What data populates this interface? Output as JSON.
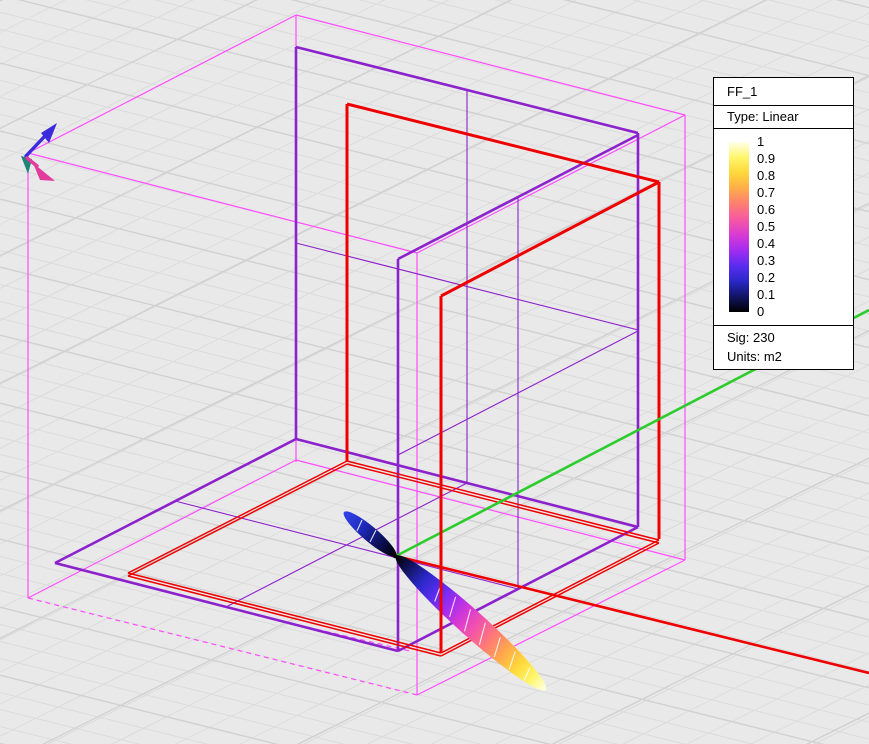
{
  "legend": {
    "title": "FF_1",
    "type_label": "Type: Linear",
    "sig_label": "Sig: 230",
    "units_label": "Units: m2",
    "scale_min": 0,
    "scale_max": 1,
    "ticks": [
      "1",
      "0.9",
      "0.8",
      "0.7",
      "0.6",
      "0.5",
      "0.4",
      "0.3",
      "0.2",
      "0.1",
      "0"
    ],
    "colorbar_stops": [
      "#ffffea",
      "#fff66a",
      "#ffd83a",
      "#ffac4a",
      "#ff7e72",
      "#f659a2",
      "#d93bd2",
      "#a32cf0",
      "#5b2df0",
      "#2a28c8",
      "#121463",
      "#000000"
    ]
  },
  "pattern": {
    "back_lobe_stops": [
      "#3444ea",
      "#202cc0",
      "#0d1060",
      "#000000"
    ]
  },
  "colors": {
    "bg": "#e9e9e9",
    "grid": "#dcdcdc",
    "gridMajor": "#d2d2d2",
    "pink": "#ff4dff",
    "purple": "#8c22cc",
    "red": "#ee0000",
    "axisGreen": "#2bcc2b",
    "axisRed": "#ee0000",
    "arrowBlue": "#3c2bdc",
    "arrowPink": "#e23a9d",
    "arrowTeal": "#1f8376",
    "legendBg": "#ffffff",
    "legendBorder": "#000000",
    "ink": "#000000"
  }
}
